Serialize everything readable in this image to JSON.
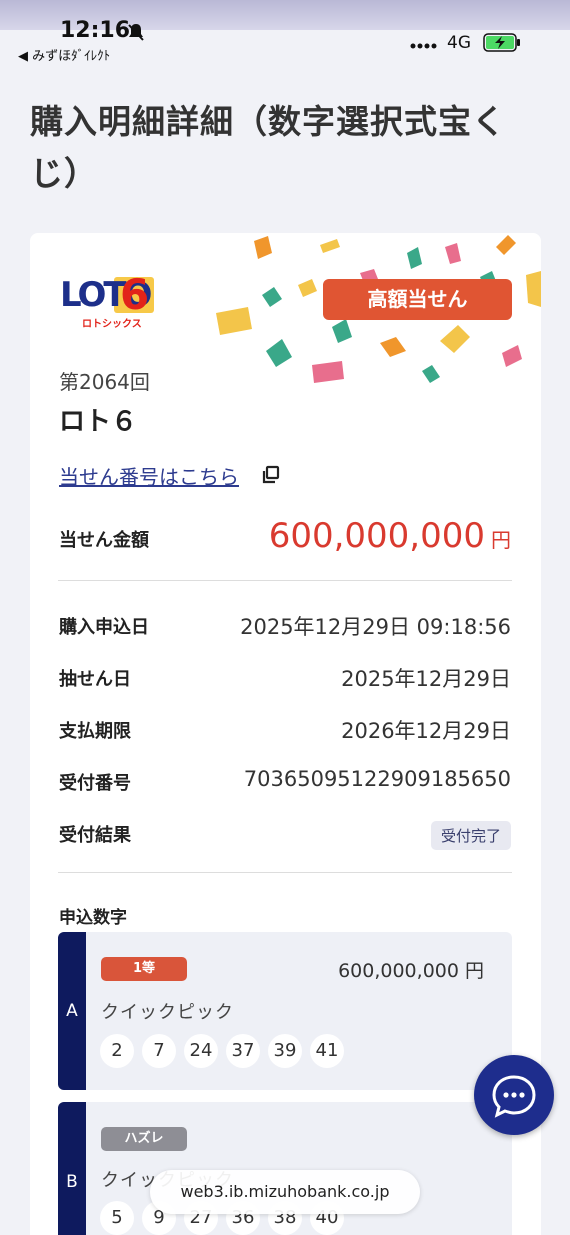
{
  "status_bar": {
    "time": "12:16",
    "back_label": "◀ みずほﾀﾞｲﾚｸﾄ",
    "network": "4G"
  },
  "page": {
    "title": "購入明細詳細（数字選択式宝くじ）"
  },
  "ticket": {
    "logo_text": "LOTO",
    "logo_number": "6",
    "logo_sub": "ロトシックス",
    "high_prize_badge": "高額当せん",
    "round": "第2064回",
    "game_name": "ロト６",
    "winning_numbers_link": "当せん番号はこちら",
    "amount_label": "当せん金額",
    "amount_value": "600,000,000",
    "amount_unit": "円",
    "details": [
      {
        "label": "購入申込日",
        "value": "2025年12月29日 09:18:56"
      },
      {
        "label": "抽せん日",
        "value": "2025年12月29日"
      },
      {
        "label": "支払期限",
        "value": "2026年12月29日"
      },
      {
        "label": "受付番号",
        "value": "7036509512290918565​0"
      }
    ],
    "result_label": "受付結果",
    "result_value": "受付完了",
    "entries_label": "申込数字",
    "entries": [
      {
        "letter": "A",
        "rank": "1等",
        "rank_color": "#d9553a",
        "prize": "600,000,000 円",
        "method": "クイックピック",
        "numbers": [
          "2",
          "7",
          "24",
          "37",
          "39",
          "41"
        ]
      },
      {
        "letter": "B",
        "rank": "ハズレ",
        "rank_color": "#8e8e95",
        "prize": "",
        "method": "クイックピック",
        "numbers": [
          "5",
          "9",
          "27",
          "36",
          "38",
          "40"
        ]
      }
    ]
  },
  "browser": {
    "url": "web3.ib.mizuhobank.co.jp"
  },
  "colors": {
    "accent_red": "#d93a2f",
    "navy": "#0e1a5e",
    "link": "#2d3b8f"
  }
}
